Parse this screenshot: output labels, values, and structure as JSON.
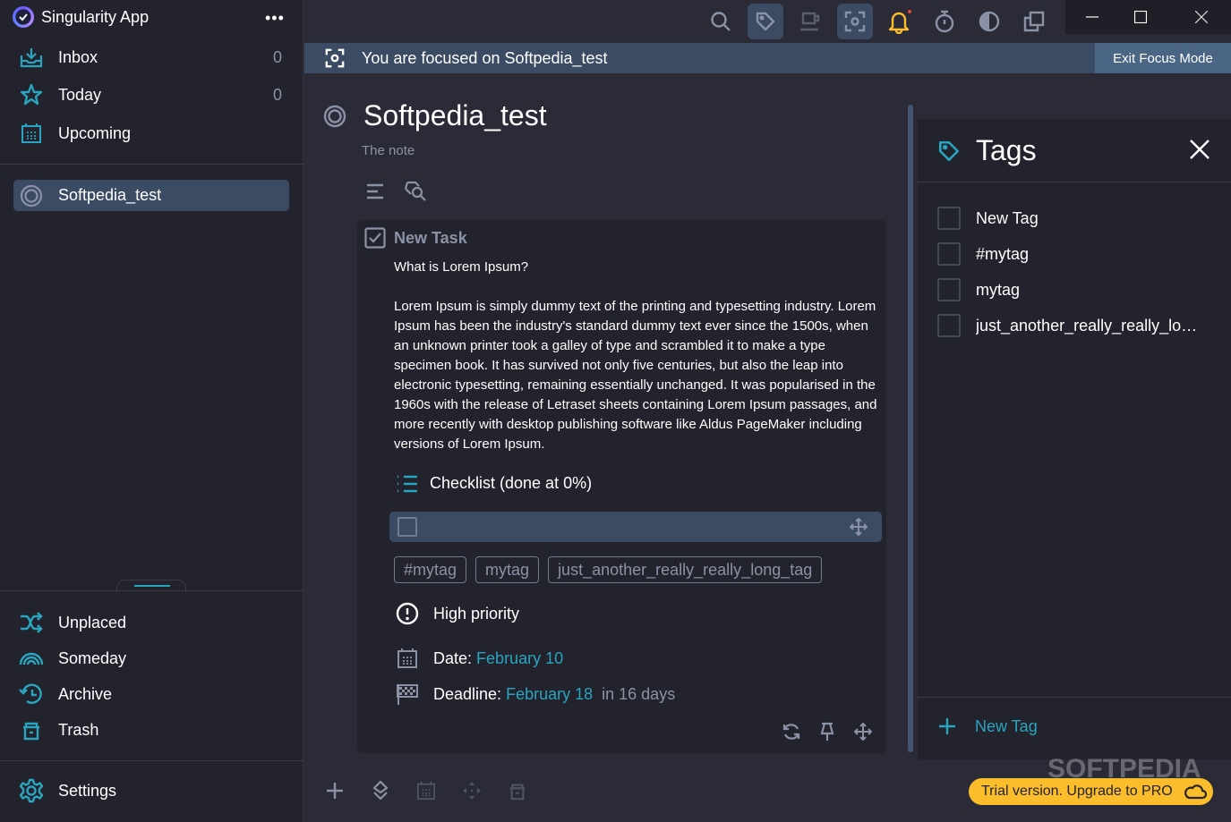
{
  "app": {
    "name": "Singularity App",
    "more_label": "•••"
  },
  "sidebar": {
    "top_items": [
      {
        "label": "Inbox",
        "count": "0",
        "icon": "inbox-icon"
      },
      {
        "label": "Today",
        "count": "0",
        "icon": "star-icon"
      },
      {
        "label": "Upcoming",
        "icon": "calendar-icon"
      }
    ],
    "projects": [
      {
        "label": "Softpedia_test",
        "icon": "project-circle-icon",
        "selected": true
      }
    ],
    "bottom_items": [
      {
        "label": "Unplaced",
        "icon": "shuffle-icon"
      },
      {
        "label": "Someday",
        "icon": "rainbow-icon"
      },
      {
        "label": "Archive",
        "icon": "history-icon"
      },
      {
        "label": "Trash",
        "icon": "trash-icon"
      }
    ],
    "settings_label": "Settings"
  },
  "toolbar": {
    "icons": [
      "search-icon",
      "tag-icon",
      "coffee-icon",
      "focus-icon",
      "bell-icon",
      "stopwatch-icon",
      "contrast-icon",
      "copy-icon"
    ],
    "active": [
      "tag-icon",
      "focus-icon"
    ]
  },
  "focus_banner": {
    "text": "You are focused on Softpedia_test",
    "exit_label": "Exit Focus Mode"
  },
  "project": {
    "title": "Softpedia_test",
    "note": "The note"
  },
  "task": {
    "title": "New Task",
    "heading": "What is Lorem Ipsum?",
    "body": "Lorem Ipsum is simply dummy text of the printing and typesetting industry. Lorem Ipsum has been the industry's standard dummy text ever since the 1500s, when an unknown printer took a galley of type and scrambled it to make a type specimen book. It has survived not only five centuries, but also the leap into electronic typesetting, remaining essentially unchanged. It was popularised in the 1960s with the release of Letraset sheets containing Lorem Ipsum passages, and more recently with desktop publishing software like Aldus PageMaker including versions of Lorem Ipsum.",
    "checklist_label": "Checklist (done at 0%)",
    "checklist_progress_percent": 0,
    "tags": [
      "#mytag",
      "mytag",
      "just_another_really_really_long_tag"
    ],
    "priority_label": "High priority",
    "date_label": "Date:",
    "date_value": "February 10",
    "deadline_label": "Deadline:",
    "deadline_value": "February 18",
    "deadline_relative": "in 16 days"
  },
  "tags_panel": {
    "title": "Tags",
    "tags": [
      {
        "label": "New Tag",
        "checked": false
      },
      {
        "label": "#mytag",
        "checked": false
      },
      {
        "label": "mytag",
        "checked": false
      },
      {
        "label": "just_another_really_really_long_tag",
        "checked": false
      }
    ],
    "new_tag_label": "New Tag"
  },
  "trial": {
    "label": "Trial version. Upgrade to PRO"
  },
  "watermark": "SOFTPEDIA",
  "colors": {
    "accent": "#2aa5bf",
    "selected": "#3b4b63",
    "bell": "#fbbd2c",
    "trial": "#fbbd2c"
  }
}
